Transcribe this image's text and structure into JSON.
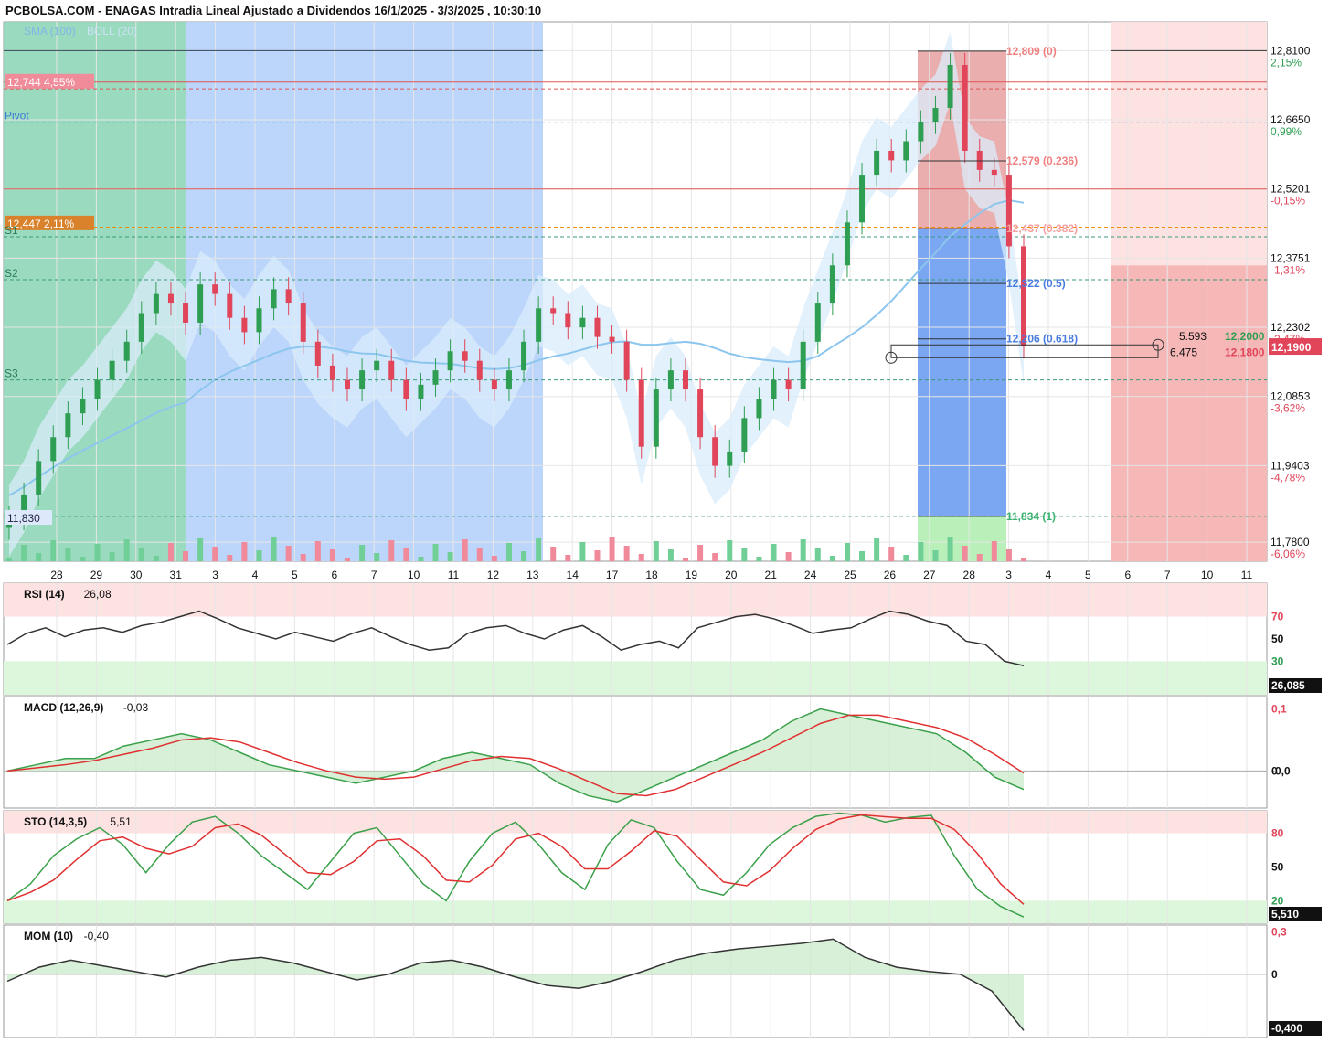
{
  "title": "PCBOLSA.COM - ENAGAS Intradia Lineal Ajustado a Dividendos 16/1/2025 - 3/3/2025 , 10:30:10",
  "colors": {
    "up": "#2e9e52",
    "down": "#e0455a",
    "sma": "#8cc6ee",
    "boll": "#d9ecfb",
    "grid": "#e6e6e6"
  },
  "chart_data": [
    {
      "type": "candlestick",
      "legend": [
        "SMA (100)",
        "BOLL (20)"
      ],
      "x_labels": [
        "28",
        "29",
        "30",
        "31",
        "3",
        "4",
        "5",
        "6",
        "7",
        "10",
        "11",
        "12",
        "13",
        "14",
        "17",
        "18",
        "19",
        "20",
        "21",
        "24",
        "25",
        "26",
        "27",
        "28",
        "3",
        "4",
        "5",
        "6",
        "7",
        "10",
        "11"
      ],
      "y_ticks": [
        {
          "value": 12.81,
          "label": "12,8100",
          "pct": "2,15%"
        },
        {
          "value": 12.665,
          "label": "12,6650",
          "pct": "0,99%"
        },
        {
          "value": 12.5201,
          "label": "12,5201",
          "pct": "-0,15%"
        },
        {
          "value": 12.3751,
          "label": "12,3751",
          "pct": "-1,31%"
        },
        {
          "value": 12.2302,
          "label": "12,2302",
          "pct": "-2,47%"
        },
        {
          "value": 12.0853,
          "label": "12,0853",
          "pct": "-3,62%"
        },
        {
          "value": 11.9403,
          "label": "11,9403",
          "pct": "-4,78%"
        },
        {
          "value": 11.78,
          "label": "11,7800",
          "pct": "-6,06%"
        }
      ],
      "ylim": [
        11.74,
        12.87
      ],
      "last_price": "12,1900",
      "bid": "12,2000",
      "ask": "12,1800",
      "bid_size": "5.593",
      "ask_size": "6.475",
      "levels": {
        "high_label": "12,744  4,55%",
        "low_label": "11,830",
        "mid_label": "12,447  2,11%",
        "pivot": "Pivot",
        "s1": "S1",
        "s2": "S2",
        "s3": "S3"
      },
      "fib": [
        {
          "value": 12.809,
          "label": "12,809 (0)"
        },
        {
          "value": 12.579,
          "label": "12,579 (0.236)"
        },
        {
          "value": 12.437,
          "label": "12,437 (0.382)"
        },
        {
          "value": 12.322,
          "label": "12,322 (0.5)"
        },
        {
          "value": 12.206,
          "label": "12,206 (0.618)"
        },
        {
          "value": 11.834,
          "label": "11,834 (1)"
        }
      ],
      "close_path": [
        11.83,
        11.88,
        11.95,
        12.0,
        12.05,
        12.08,
        12.12,
        12.16,
        12.2,
        12.26,
        12.3,
        12.28,
        12.24,
        12.32,
        12.3,
        12.25,
        12.22,
        12.27,
        12.31,
        12.28,
        12.2,
        12.15,
        12.12,
        12.1,
        12.14,
        12.16,
        12.12,
        12.08,
        12.11,
        12.14,
        12.18,
        12.16,
        12.12,
        12.1,
        12.14,
        12.2,
        12.27,
        12.26,
        12.23,
        12.25,
        12.21,
        12.2,
        12.12,
        11.98,
        12.1,
        12.14,
        12.1,
        12.0,
        11.94,
        11.97,
        12.04,
        12.08,
        12.12,
        12.1,
        12.2,
        12.28,
        12.36,
        12.45,
        12.55,
        12.6,
        12.58,
        12.62,
        12.66,
        12.69,
        12.78,
        12.6,
        12.56,
        12.55,
        12.4,
        12.19
      ]
    },
    {
      "type": "line",
      "name": "RSI (14)",
      "value": "26,08",
      "last": "26,085",
      "ticks": [
        "70",
        "50",
        "30"
      ],
      "values": [
        45,
        55,
        60,
        52,
        58,
        60,
        56,
        62,
        65,
        70,
        75,
        68,
        60,
        55,
        50,
        56,
        52,
        48,
        55,
        60,
        52,
        45,
        40,
        42,
        55,
        60,
        62,
        55,
        50,
        58,
        62,
        52,
        40,
        45,
        48,
        42,
        60,
        65,
        70,
        72,
        68,
        62,
        55,
        58,
        60,
        68,
        75,
        72,
        66,
        62,
        48,
        45,
        30,
        26
      ]
    },
    {
      "type": "line",
      "name": "MACD (12,26,9)",
      "value": "-0,03",
      "ticks": [
        "0,1",
        "0",
        "-0,0"
      ],
      "values": [
        0.0,
        0.01,
        0.02,
        0.02,
        0.04,
        0.05,
        0.06,
        0.05,
        0.03,
        0.01,
        0.0,
        -0.01,
        -0.02,
        -0.01,
        0.0,
        0.02,
        0.03,
        0.02,
        0.01,
        -0.02,
        -0.04,
        -0.05,
        -0.03,
        -0.01,
        0.01,
        0.03,
        0.05,
        0.08,
        0.1,
        0.09,
        0.08,
        0.07,
        0.06,
        0.03,
        -0.01,
        -0.03
      ]
    },
    {
      "type": "line",
      "name": "STO (14,3,5)",
      "value": "5,51",
      "last": "5,510",
      "ticks": [
        "80",
        "50",
        "20"
      ],
      "values": [
        20,
        35,
        60,
        75,
        85,
        70,
        45,
        70,
        90,
        95,
        80,
        60,
        45,
        30,
        55,
        80,
        85,
        60,
        35,
        20,
        55,
        80,
        90,
        70,
        45,
        30,
        70,
        92,
        85,
        55,
        30,
        25,
        45,
        70,
        85,
        95,
        98,
        96,
        90,
        94,
        96,
        60,
        30,
        15,
        5.5
      ]
    },
    {
      "type": "line",
      "name": "MOM (10)",
      "value": "-0,40",
      "last": "-0,400",
      "ticks": [
        "0,3",
        "0"
      ],
      "values": [
        -0.05,
        0.05,
        0.1,
        0.06,
        0.02,
        -0.02,
        0.05,
        0.1,
        0.12,
        0.08,
        0.02,
        -0.04,
        0.0,
        0.08,
        0.1,
        0.05,
        -0.02,
        -0.08,
        -0.1,
        -0.05,
        0.02,
        0.1,
        0.15,
        0.18,
        0.2,
        0.22,
        0.25,
        0.12,
        0.05,
        0.02,
        0.0,
        -0.12,
        -0.4
      ]
    }
  ]
}
